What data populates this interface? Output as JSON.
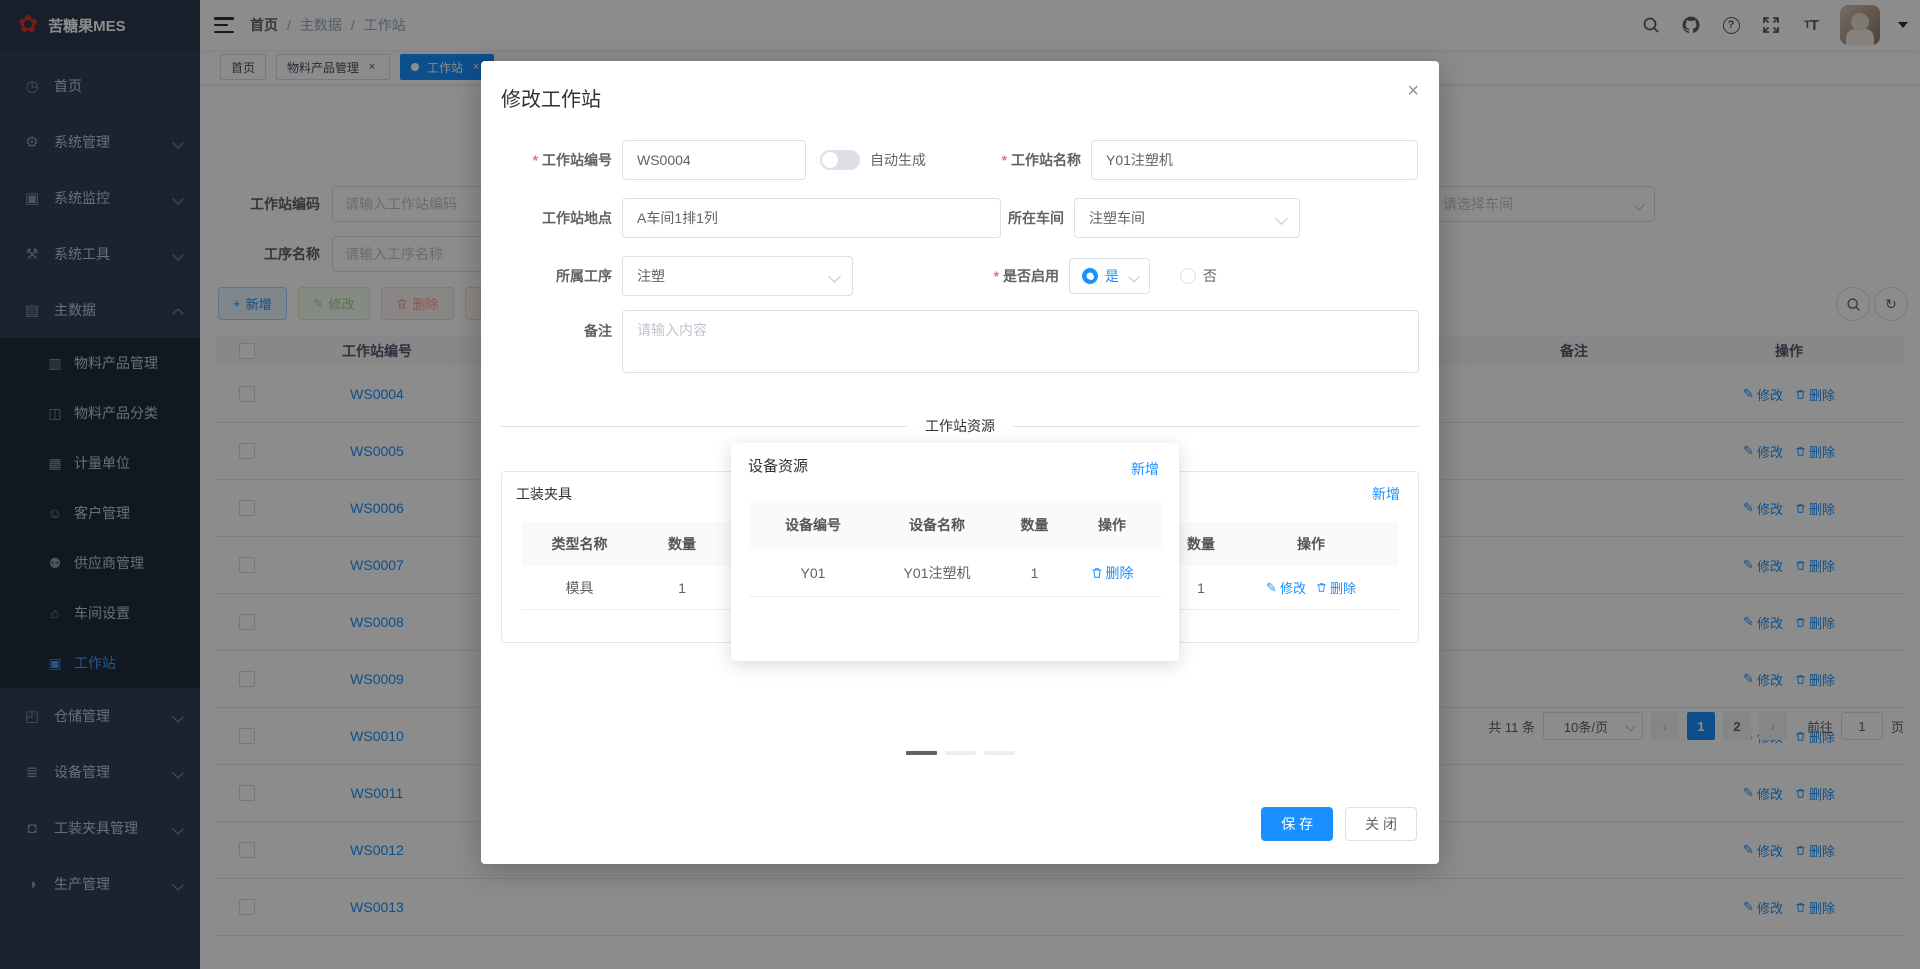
{
  "app": {
    "title": "苦糖果MES"
  },
  "navbar": {
    "breadcrumb": [
      "首页",
      "主数据",
      "工作站"
    ],
    "icons": [
      "search-icon",
      "github-icon",
      "help-icon",
      "fullscreen-icon",
      "font-size-icon",
      "avatar"
    ]
  },
  "tabs": [
    {
      "label": "首页",
      "closable": false,
      "active": false
    },
    {
      "label": "物料产品管理",
      "closable": true,
      "active": false
    },
    {
      "label": "工作站",
      "closable": true,
      "active": true
    }
  ],
  "close_glyph": "×",
  "sidebar": {
    "items": [
      {
        "icon": "◷",
        "label": "首页"
      },
      {
        "icon": "⚙",
        "label": "系统管理"
      },
      {
        "icon": "▣",
        "label": "系统监控"
      },
      {
        "icon": "⚒",
        "label": "系统工具"
      },
      {
        "icon": "▤",
        "label": "主数据",
        "expanded": true,
        "children": [
          {
            "icon": "▥",
            "label": "物料产品管理"
          },
          {
            "icon": "◫",
            "label": "物料产品分类"
          },
          {
            "icon": "▦",
            "label": "计量单位"
          },
          {
            "icon": "☺",
            "label": "客户管理"
          },
          {
            "icon": "⚉",
            "label": "供应商管理"
          },
          {
            "icon": "⌂",
            "label": "车间设置"
          },
          {
            "icon": "▣",
            "label": "工作站",
            "active": true
          }
        ]
      },
      {
        "icon": "◰",
        "label": "仓储管理"
      },
      {
        "icon": "≣",
        "label": "设备管理"
      },
      {
        "icon": "◘",
        "label": "工装夹具管理"
      },
      {
        "icon": "◑",
        "label": "生产管理"
      }
    ]
  },
  "filter": {
    "code": {
      "label": "工作站编码",
      "placeholder": "请输入工作站编码"
    },
    "process": {
      "label": "工序名称",
      "placeholder": "请输入工序名称"
    },
    "workshop": {
      "placeholder": "请选择车间"
    }
  },
  "toolbar": {
    "add": "新增",
    "edit": "修改",
    "delete": "删除"
  },
  "table": {
    "headers": {
      "code": "工作站编号",
      "remark": "备注",
      "op": "操作"
    },
    "row_actions": {
      "edit": "修改",
      "delete": "删除"
    },
    "rows": [
      {
        "code": "WS0004"
      },
      {
        "code": "WS0005"
      },
      {
        "code": "WS0006"
      },
      {
        "code": "WS0007"
      },
      {
        "code": "WS0008"
      },
      {
        "code": "WS0009"
      },
      {
        "code": "WS0010"
      },
      {
        "code": "WS0011"
      },
      {
        "code": "WS0012"
      },
      {
        "code": "WS0013"
      }
    ]
  },
  "pagination": {
    "total": "共 11 条",
    "page_size": "10条/页",
    "prev": "‹",
    "next": "›",
    "pages": [
      "1",
      "2"
    ],
    "active_page": "1",
    "goto_label": "前往",
    "goto_value": "1",
    "page_label": "页"
  },
  "dialog": {
    "title": "修改工作站",
    "fields": {
      "ws_code": {
        "label": "工作站编号",
        "value": "WS0004",
        "auto_label": "自动生成"
      },
      "ws_name": {
        "label": "工作站名称",
        "value": "Y01注塑机"
      },
      "location": {
        "label": "工作站地点",
        "value": "A车间1排1列"
      },
      "workshop": {
        "label": "所在车间",
        "value": "注塑车间"
      },
      "process": {
        "label": "所属工序",
        "value": "注塑"
      },
      "enabled": {
        "label": "是否启用",
        "yes": "是",
        "no": "否",
        "selected": "是"
      },
      "remark": {
        "label": "备注",
        "placeholder": "请输入内容"
      }
    },
    "resources": {
      "divider": "工作站资源",
      "fixture_card": {
        "title": "工装夹具",
        "headers": {
          "type": "类型名称",
          "qty": "数量"
        },
        "row": {
          "type": "模具",
          "qty": "1"
        }
      },
      "equipment_popup": {
        "title": "设备资源",
        "add": "新增",
        "headers": {
          "code": "设备编号",
          "name": "设备名称",
          "qty": "数量",
          "op": "操作"
        },
        "row": {
          "code": "Y01",
          "name": "Y01注塑机",
          "qty": "1",
          "delete": "删除"
        }
      },
      "right_card": {
        "add": "新增",
        "headers": {
          "qty": "数量",
          "op": "操作"
        },
        "row": {
          "qty": "1",
          "edit": "修改",
          "delete": "删除"
        }
      }
    },
    "footer": {
      "save": "保 存",
      "close": "关 闭"
    }
  },
  "icons_map": {
    "logo-icon": "✿",
    "edit-icon": "✎",
    "delete-icon": "trash-svg",
    "search-icon": "magnifier-svg",
    "refresh-icon": "↻",
    "add-icon": "+"
  }
}
